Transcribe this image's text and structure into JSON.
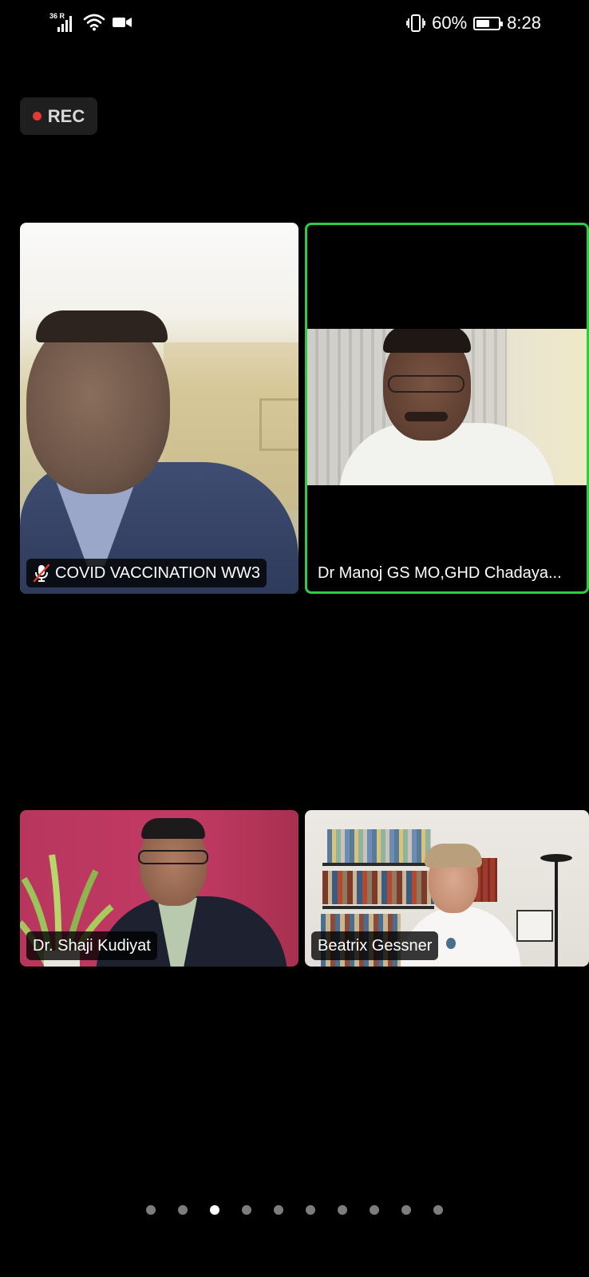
{
  "status_bar": {
    "network_label": "36 R",
    "battery_percent_text": "60%",
    "battery_level": 0.6,
    "time": "8:28",
    "icons": [
      "signal-icon",
      "wifi-icon",
      "video-camera-icon",
      "vibrate-icon",
      "battery-icon"
    ]
  },
  "recording": {
    "label": "REC",
    "dot_color": "#e33b33"
  },
  "participants": [
    {
      "name": "COVID VACCINATION WW3",
      "muted": true,
      "active_speaker": false
    },
    {
      "name": "Dr Manoj GS MO,GHD Chadaya...",
      "muted": false,
      "active_speaker": true
    },
    {
      "name": "Dr. Shaji Kudiyat",
      "muted": false,
      "active_speaker": false
    },
    {
      "name": "Beatrix Gessner",
      "muted": false,
      "active_speaker": false
    }
  ],
  "active_speaker_color": "#2ecc40",
  "pagination": {
    "total_pages": 10,
    "current_page": 3
  }
}
